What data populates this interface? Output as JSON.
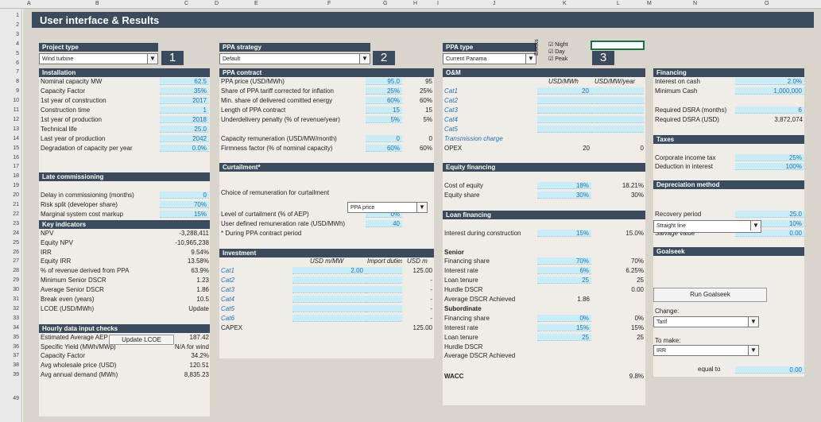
{
  "columns": [
    "A",
    "B",
    "C",
    "D",
    "E",
    "F",
    "G",
    "H",
    "I",
    "J",
    "K",
    "L",
    "M",
    "N",
    "O"
  ],
  "rows": [
    "1",
    "2",
    "3",
    "4",
    "5",
    "6",
    "7",
    "8",
    "9",
    "10",
    "11",
    "12",
    "13",
    "14",
    "15",
    "16",
    "17",
    "18",
    "19",
    "20",
    "21",
    "22",
    "23",
    "24",
    "25",
    "26",
    "27",
    "28",
    "29",
    "30",
    "31",
    "32",
    "33",
    "34",
    "35",
    "36",
    "37",
    "38",
    "39",
    "49"
  ],
  "title": "User interface & Results",
  "badges": [
    "1",
    "2",
    "3"
  ],
  "project": {
    "header": "Project type",
    "value": "Wind turbine"
  },
  "strategy": {
    "header": "PPA strategy",
    "value": "Default"
  },
  "ppatype": {
    "header": "PPA type",
    "value": "Current Panama",
    "blocks": "Blocks",
    "night": "Night",
    "day": "Day",
    "peak": "Peak",
    "check": "☑"
  },
  "installation": {
    "header": "Installation",
    "rows": [
      {
        "l": "Nominal capacity MW",
        "v": "62.5"
      },
      {
        "l": "Capacity Factor",
        "v": "35%"
      },
      {
        "l": "1st year of construction",
        "v": "2017"
      },
      {
        "l": "Construction time",
        "v": "1"
      },
      {
        "l": "1st year of production",
        "v": "2018"
      },
      {
        "l": "Technical life",
        "v": "25.0"
      },
      {
        "l": "Last year of production",
        "v": "2042"
      },
      {
        "l": "Degradation of capacity per year",
        "v": "0.0%"
      }
    ]
  },
  "late": {
    "header": "Late commissioning",
    "rows": [
      {
        "l": "Delay in commissioning (months)",
        "v": "0"
      },
      {
        "l": "Risk split (developer share)",
        "v": "70%"
      },
      {
        "l": "Marginal system cost markup",
        "v": "15%"
      }
    ]
  },
  "key": {
    "header": "Key indicators",
    "rows": [
      {
        "l": "NPV",
        "v": "-3,288,411"
      },
      {
        "l": "Equity NPV",
        "v": "-10,965,238"
      },
      {
        "l": "IRR",
        "v": "9.54%"
      },
      {
        "l": "Equity IRR",
        "v": "13.58%"
      },
      {
        "l": "% of revenue derived from PPA",
        "v": "63.9%"
      },
      {
        "l": "Minimum Senior DSCR",
        "v": "1.23"
      },
      {
        "l": "Average Senior DSCR",
        "v": "1.86"
      },
      {
        "l": "Break even (years)",
        "v": "10.5"
      },
      {
        "l": "LCOE (USD/MWh)",
        "v": "Update"
      }
    ],
    "btn": "Update LCOE"
  },
  "hourly": {
    "header": "Hourly data input checks",
    "rows": [
      {
        "l": "Estimated Average AEP (MWh)",
        "v": "187.42"
      },
      {
        "l": "Specific Yield (MWh/MWp)",
        "v": "N/A for wind"
      },
      {
        "l": "Capacity Factor",
        "v": "34.2%"
      },
      {
        "l": "Avg wholesale price (USD)",
        "v": "120.51"
      },
      {
        "l": "Avg annual demand (MWh)",
        "v": "8,835.23"
      }
    ]
  },
  "ppa": {
    "header": "PPA contract",
    "rows": [
      {
        "l": "PPA price (USD/MWh)",
        "v": "95.0",
        "c": "95"
      },
      {
        "l": "Share of PPA tariff corrected for inflation",
        "v": "25%",
        "c": "25%"
      },
      {
        "l": "Min. share of delivered comitted energy",
        "v": "60%",
        "c": "60%"
      },
      {
        "l": "Length of PPA contract",
        "v": "15",
        "c": "15"
      },
      {
        "l": "Underdelivery penalty (% of revenue/year)",
        "v": "5%",
        "c": "5%"
      }
    ],
    "rows2": [
      {
        "l": "Capacity remuneration (USD/MW/month)",
        "v": "0",
        "c": "0"
      },
      {
        "l": "Firmness factor (% of nominal capacity)",
        "v": "60%",
        "c": "60%"
      }
    ]
  },
  "curt": {
    "header": "Curtailment*",
    "choice": "Choice of remuneration for curtailment",
    "choiceval": "PPA price",
    "level": "Level of curtailment (% of AEP)",
    "levelv": "0%",
    "user": "User defined remuneration rate (USD/MWh)",
    "userv": "40",
    "note": "* During PPA contract period"
  },
  "inv": {
    "header": "Investment",
    "c1": "USD m/MW",
    "c2": "Import duties",
    "c3": "USD m",
    "rows": [
      {
        "l": "Cat1",
        "a": "2.00",
        "c": "125.00"
      },
      {
        "l": "Cat2",
        "a": "",
        "c": "-"
      },
      {
        "l": "Cat3",
        "a": "",
        "c": "-"
      },
      {
        "l": "Cat4",
        "a": "",
        "c": "-"
      },
      {
        "l": "Cat5",
        "a": "",
        "c": "-"
      },
      {
        "l": "Cat6",
        "a": "",
        "c": "-"
      }
    ],
    "capex": "CAPEX",
    "capexv": "125.00"
  },
  "om": {
    "header": "O&M",
    "c1": "USD/MWh",
    "c2": "USD/MW/year",
    "rows": [
      {
        "l": "Cat1",
        "v": "20"
      },
      {
        "l": "Cat2",
        "v": ""
      },
      {
        "l": "Cat3",
        "v": ""
      },
      {
        "l": "Cat4",
        "v": ""
      },
      {
        "l": "Cat5",
        "v": ""
      },
      {
        "l": "Transmission charge",
        "v": ""
      }
    ],
    "opex": "OPEX",
    "opexa": "20",
    "opexb": "0"
  },
  "eq": {
    "header": "Equity financing",
    "rows": [
      {
        "l": "Cost of equity",
        "v": "18%",
        "c": "18.21%"
      },
      {
        "l": "Equity share",
        "v": "30%",
        "c": "30%"
      }
    ]
  },
  "loan": {
    "header": "Loan financing",
    "idc": "Interest during construction",
    "idcv": "15%",
    "idcc": "15.0%",
    "senior": "Senior",
    "srows": [
      {
        "l": "Financing share",
        "v": "70%",
        "c": "70%"
      },
      {
        "l": "Interest rate",
        "v": "6%",
        "c": "6.25%"
      },
      {
        "l": "Loan tenure",
        "v": "25",
        "c": "25"
      },
      {
        "l": "Hurdle DSCR",
        "v": "",
        "c": "0.00"
      },
      {
        "l": "Average DSCR Achieved",
        "v": "1.86",
        "c": ""
      }
    ],
    "sub": "Subordinate",
    "brows": [
      {
        "l": "Financing share",
        "v": "0%",
        "c": "0%"
      },
      {
        "l": "Interest rate",
        "v": "15%",
        "c": "15%"
      },
      {
        "l": "Loan tenure",
        "v": "25",
        "c": "25"
      },
      {
        "l": "Hurdle DSCR",
        "v": "",
        "c": ""
      },
      {
        "l": "Average DSCR Achieved",
        "v": "",
        "c": ""
      }
    ],
    "wacc": "WACC",
    "waccv": "9.8%"
  },
  "fin": {
    "header": "Financing",
    "rows": [
      {
        "l": "Interest on cash",
        "v": "2.0%"
      },
      {
        "l": "Minimum Cash",
        "v": "1,000,000"
      }
    ],
    "dsra": "Required DSRA (months)",
    "dsrav": "6",
    "dsrausd": "Required DSRA (USD)",
    "dsrausdv": "3,872,074"
  },
  "tax": {
    "header": "Taxes",
    "rows": [
      {
        "l": "Corporate income tax",
        "v": "25%"
      },
      {
        "l": "Deduction in interest",
        "v": "100%"
      }
    ]
  },
  "dep": {
    "header": "Depreciation method",
    "method": "Straight line",
    "rows": [
      {
        "l": "Recovery period",
        "v": "25.0"
      },
      {
        "l": "Depreciation rate",
        "v": "10%"
      },
      {
        "l": "Salvage value",
        "v": "0.00"
      }
    ]
  },
  "goal": {
    "header": "Goalseek",
    "btn": "Run Goalseek",
    "change": "Change:",
    "changev": "Tarif",
    "make": "To make:",
    "makev": "IRR",
    "equal": "equal to",
    "equalv": "0.00"
  }
}
